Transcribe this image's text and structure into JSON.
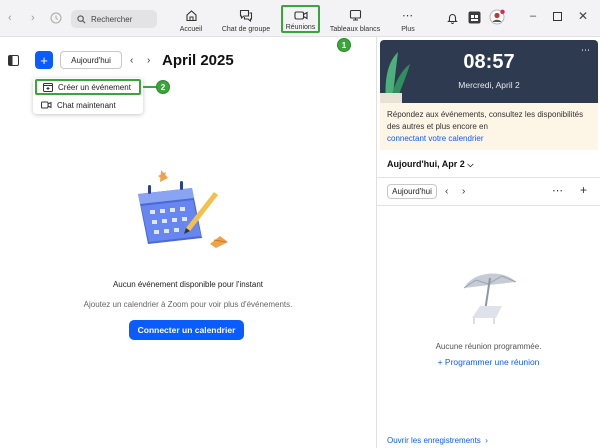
{
  "window": {
    "search_placeholder": "Rechercher",
    "tabs": [
      {
        "label": "Accueil",
        "icon": "home-icon"
      },
      {
        "label": "Chat de groupe",
        "icon": "chat-icon"
      },
      {
        "label": "Réunions",
        "icon": "video-camera-icon",
        "active": true
      },
      {
        "label": "Tableaux blancs",
        "icon": "whiteboard-icon"
      },
      {
        "label": "Plus",
        "icon": "more-dots-icon"
      }
    ],
    "callout_1": "1",
    "callout_2": "2",
    "accent_color": "#0b5cff",
    "highlight_color": "#3aa53a"
  },
  "calendar": {
    "today_button": "Aujourd'hui",
    "month_title": "April 2025",
    "menu": {
      "create_event": "Créer un événement",
      "chat_now": "Chat maintenant"
    },
    "empty_title": "Aucun événement disponible pour l'instant",
    "empty_subtitle": "Ajoutez un calendrier à Zoom pour voir plus d'événements.",
    "connect_button": "Connecter un calendrier"
  },
  "sidepanel": {
    "time": "08:57",
    "date": "Mercredi, April 2",
    "notice_text": "Répondez aux événements, consultez les disponibilités des autres et plus encore en",
    "notice_link": "connectant votre calendrier",
    "today_label": "Aujourd'hui, Apr 2",
    "today_button": "Aujourd'hui",
    "no_meetings": "Aucune réunion programmée.",
    "schedule_link": "Programmer une réunion",
    "recordings_link": "Ouvrir les enregistrements"
  }
}
